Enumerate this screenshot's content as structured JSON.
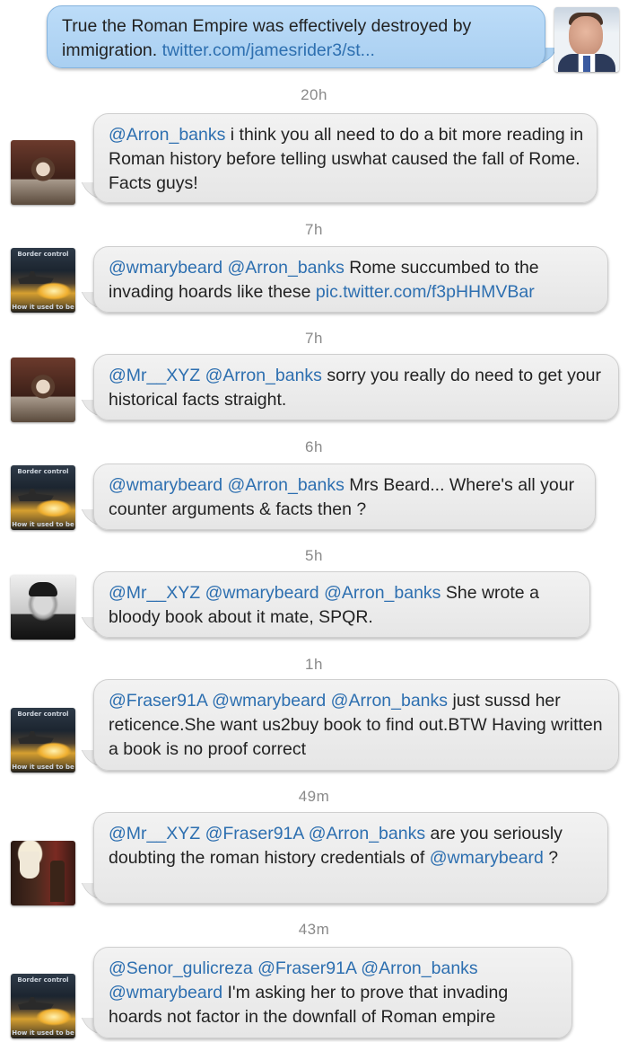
{
  "messages": [
    {
      "time": null,
      "side": "out",
      "avatar": "arron-banks-avatar",
      "parts": [
        {
          "t": "True the Roman Empire was effectively destroyed by immigration. "
        },
        {
          "t": "twitter.com/jamesrider3/st...",
          "k": "link"
        }
      ]
    },
    {
      "time": "20h",
      "side": "in",
      "avatar": "wmarybeard-avatar",
      "parts": [
        {
          "t": "@Arron_banks",
          "k": "m"
        },
        {
          "t": " i think you all need to do a bit more reading in Roman history before telling uswhat caused the fall of Rome. Facts guys!"
        }
      ]
    },
    {
      "time": "7h",
      "side": "in",
      "avatar": "border-control-avatar",
      "parts": [
        {
          "t": "@wmarybeard @Arron_banks",
          "k": "m"
        },
        {
          "t": " Rome succumbed to the invading hoards like these "
        },
        {
          "t": "pic.twitter.com/f3pHHMVBar",
          "k": "link"
        }
      ]
    },
    {
      "time": "7h",
      "side": "in",
      "avatar": "wmarybeard-avatar",
      "parts": [
        {
          "t": "@Mr__XYZ @Arron_banks",
          "k": "m"
        },
        {
          "t": " sorry you really do need to get your historical facts straight."
        }
      ]
    },
    {
      "time": "6h",
      "side": "in",
      "avatar": "border-control-avatar",
      "parts": [
        {
          "t": "@wmarybeard @Arron_banks",
          "k": "m"
        },
        {
          "t": " Mrs Beard... Where's all your counter arguments & facts then ?"
        }
      ]
    },
    {
      "time": "5h",
      "side": "in",
      "avatar": "fraser91a-avatar",
      "parts": [
        {
          "t": "@Mr__XYZ @wmarybeard @Arron_banks",
          "k": "m"
        },
        {
          "t": " She wrote a bloody book about it mate, SPQR."
        }
      ]
    },
    {
      "time": "1h",
      "side": "in",
      "avatar": "border-control-avatar",
      "parts": [
        {
          "t": "@Fraser91A @wmarybeard @Arron_banks",
          "k": "m"
        },
        {
          "t": " just sussd her reticence.She want us2buy book to find out.BTW Having written a book is no proof correct"
        }
      ]
    },
    {
      "time": "49m",
      "side": "in",
      "avatar": "senor-gulicreza-avatar",
      "parts": [
        {
          "t": "@Mr__XYZ @Fraser91A @Arron_banks",
          "k": "m"
        },
        {
          "t": " are you seriously doubting the roman history credentials of "
        },
        {
          "t": "@wmarybeard",
          "k": "m"
        },
        {
          "t": " ?"
        }
      ]
    },
    {
      "time": "43m",
      "side": "in",
      "avatar": "border-control-avatar",
      "parts": [
        {
          "t": "@Senor_gulicreza @Fraser91A @Arron_banks @wmarybeard",
          "k": "m"
        },
        {
          "t": " I'm asking her to prove that invading hoards not factor in the downfall of Roman empire"
        }
      ]
    }
  ],
  "avatar_captions": {
    "top": "Border control",
    "bottom": "How it used to be"
  },
  "colors": {
    "mention": "#2d6fb0",
    "outgoing_bubble": "#b3d6f5",
    "incoming_bubble": "#ececec",
    "timestamp": "#8a8a8a"
  }
}
